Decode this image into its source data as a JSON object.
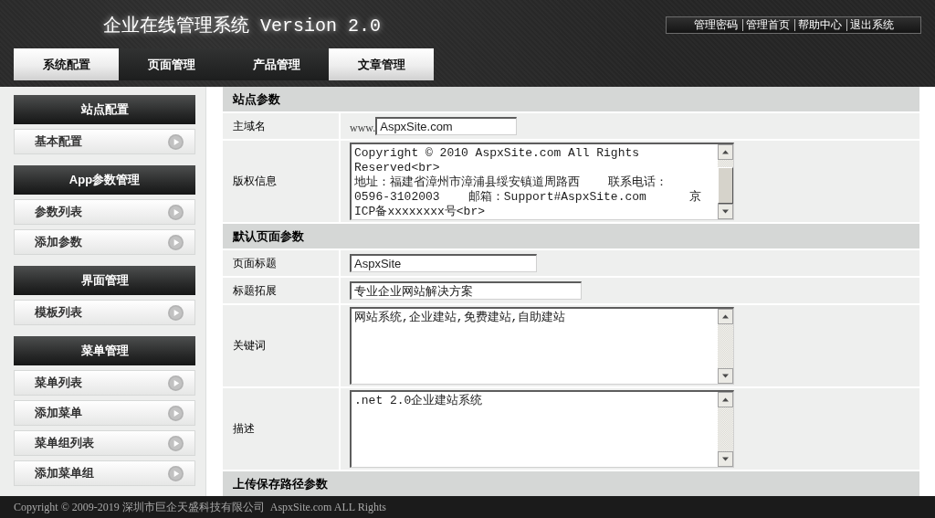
{
  "header": {
    "title": "企业在线管理系统 Version 2.0",
    "links": [
      "管理密码",
      "管理首页",
      "帮助中心",
      "退出系统"
    ]
  },
  "nav": {
    "tabs": [
      {
        "label": "系统配置",
        "selected": true
      },
      {
        "label": "页面管理",
        "selected": false
      },
      {
        "label": "产品管理",
        "selected": false
      },
      {
        "label": "文章管理",
        "selected": true
      }
    ]
  },
  "sidebar": {
    "groups": [
      {
        "title": "站点配置",
        "items": [
          "基本配置"
        ]
      },
      {
        "title": "App参数管理",
        "items": [
          "参数列表",
          "添加参数"
        ]
      },
      {
        "title": "界面管理",
        "items": [
          "模板列表"
        ]
      },
      {
        "title": "菜单管理",
        "items": [
          "菜单列表",
          "添加菜单",
          "菜单组列表",
          "添加菜单组"
        ]
      }
    ]
  },
  "form": {
    "sections": [
      {
        "title": "站点参数",
        "rows": [
          {
            "label": "主域名",
            "kind": "input",
            "prefix": "www.",
            "value": "AspxSite.com"
          },
          {
            "label": "版权信息",
            "kind": "textarea",
            "overflow": true,
            "lines": [
              "Copyright © 2010 AspxSite.com All Rights",
              "Reserved<br>",
              "地址：福建省漳州市漳浦县绥安镇道周路西    联系电话：",
              "0596-3102003    邮箱：Support#AspxSite.com      京",
              "ICP备xxxxxxxx号<br>"
            ]
          }
        ]
      },
      {
        "title": "默认页面参数",
        "rows": [
          {
            "label": "页面标题",
            "kind": "input",
            "value": "AspxSite"
          },
          {
            "label": "标题拓展",
            "kind": "input",
            "value": "专业企业网站解决方案"
          },
          {
            "label": "关键词",
            "kind": "textarea",
            "overflow": false,
            "lines": [
              "网站系统,企业建站,免费建站,自助建站"
            ]
          },
          {
            "label": "描述",
            "kind": "textarea",
            "overflow": false,
            "lines": [
              ".net 2.0企业建站系统"
            ]
          }
        ]
      },
      {
        "title": "上传保存路径参数"
      }
    ]
  },
  "footer": {
    "text": "Copyright © 2009-2019 深圳市巨企天盛科技有限公司  AspxSite.com ALL Rights"
  }
}
